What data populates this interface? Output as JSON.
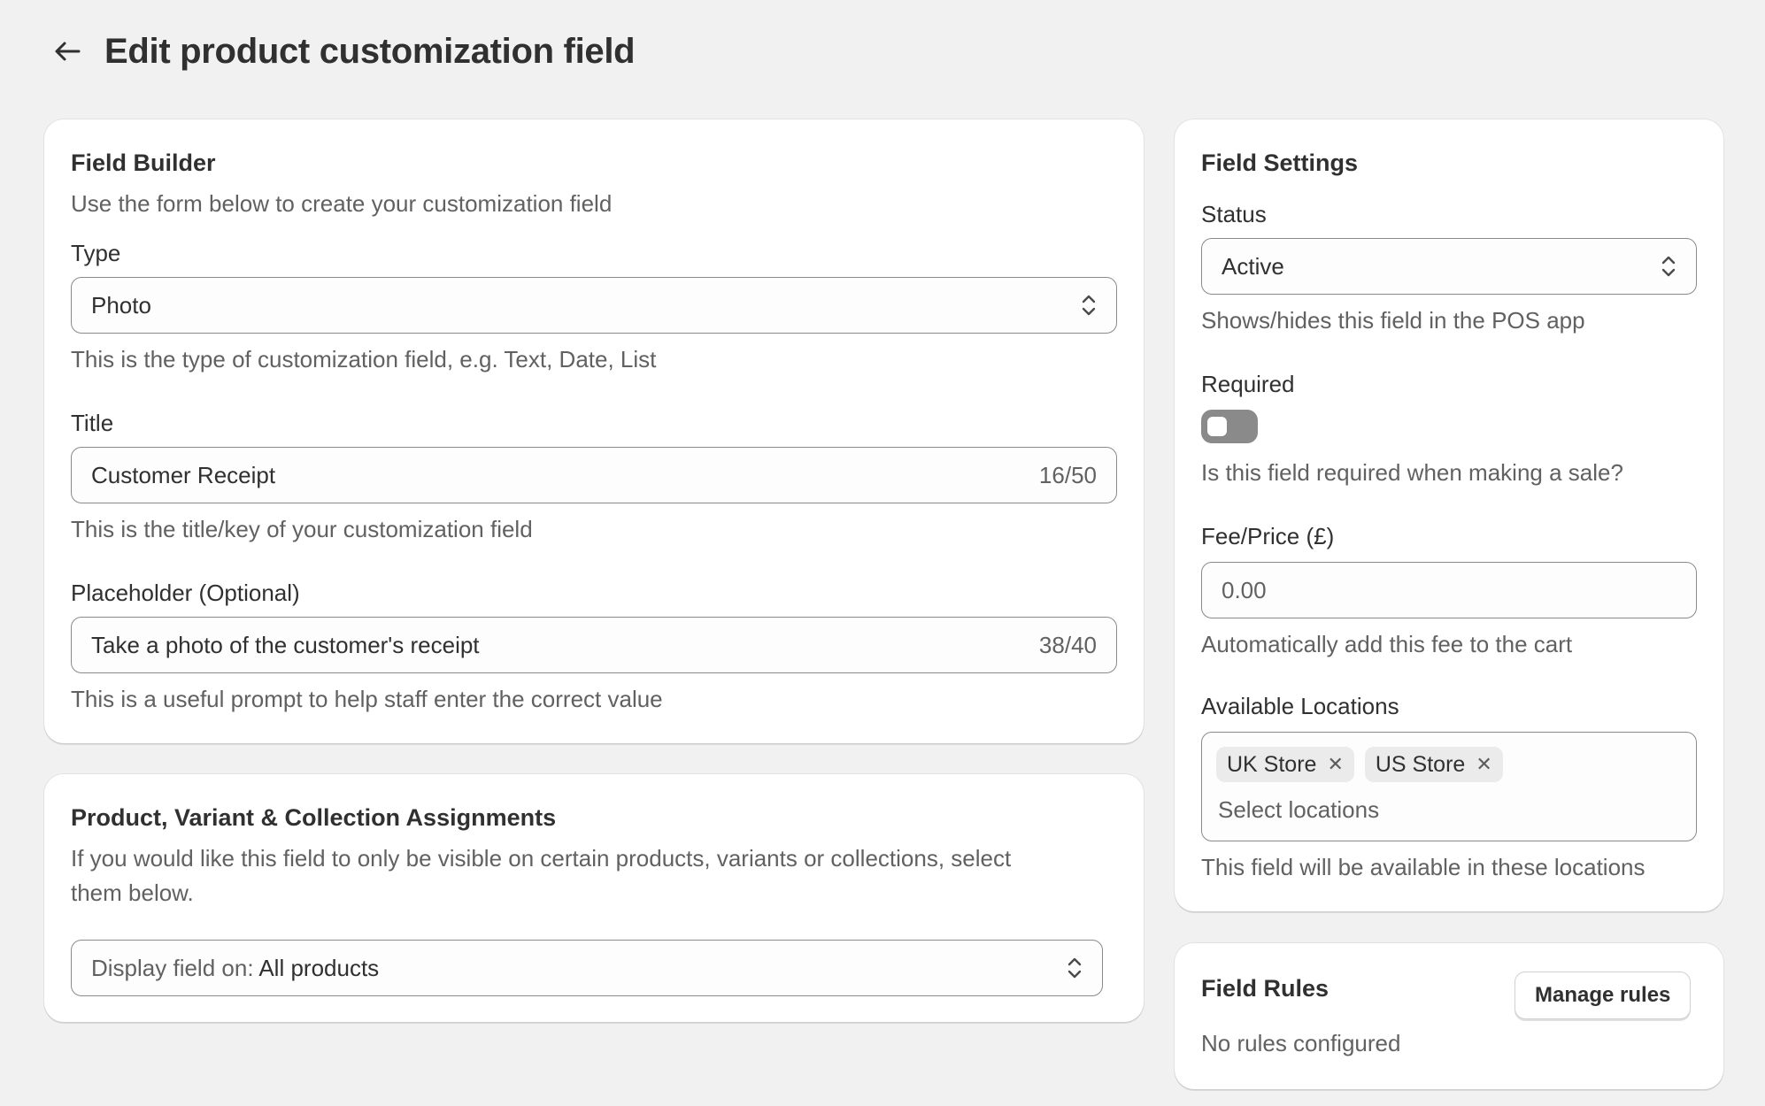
{
  "header": {
    "title": "Edit product customization field",
    "back_icon": "arrow-left-icon"
  },
  "field_builder": {
    "title": "Field Builder",
    "description": "Use the form below to create your customization field",
    "type": {
      "label": "Type",
      "value": "Photo",
      "help": "This is the type of customization field, e.g. Text, Date, List"
    },
    "field_title": {
      "label": "Title",
      "value": "Customer Receipt",
      "counter": "16/50",
      "help": "This is the title/key of your customization field"
    },
    "placeholder": {
      "label": "Placeholder (Optional)",
      "value": "Take a photo of the customer's receipt",
      "counter": "38/40",
      "help": "This is a useful prompt to help staff enter the correct value"
    }
  },
  "assignments": {
    "title": "Product, Variant & Collection Assignments",
    "description_line1": "If you would like this field to only be visible on certain products, variants or collections, select",
    "description_line2": "them below.",
    "display_prefix": "Display field on:",
    "display_value": "All products"
  },
  "settings": {
    "title": "Field Settings",
    "status": {
      "label": "Status",
      "value": "Active",
      "help": "Shows/hides this field in the POS app"
    },
    "required": {
      "label": "Required",
      "enabled": false,
      "help": "Is this field required when making a sale?"
    },
    "fee": {
      "label": "Fee/Price (£)",
      "placeholder": "0.00",
      "help": "Automatically add this fee to the cart"
    },
    "locations": {
      "label": "Available Locations",
      "tags": [
        "UK Store",
        "US Store"
      ],
      "placeholder": "Select locations",
      "help": "This field will be available in these locations"
    }
  },
  "rules": {
    "title": "Field Rules",
    "button": "Manage rules",
    "empty": "No rules configured"
  }
}
